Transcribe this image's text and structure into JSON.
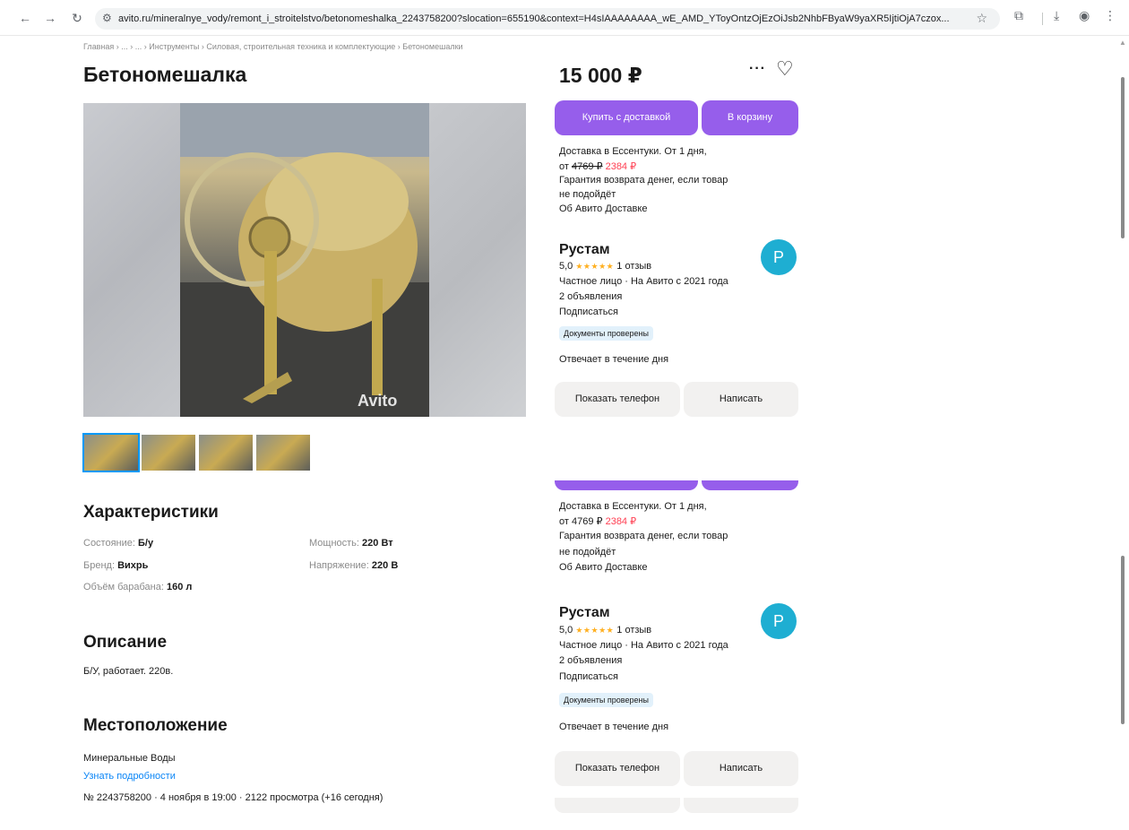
{
  "browser": {
    "url": "avito.ru/mineralnye_vody/remont_i_stroitelstvo/betonomeshalka_2243758200?slocation=655190&context=H4sIAAAAAAAA_wE_AMD_YToyOntzOjEzOiJsb2NhbFByaW9yaXR5IjtiOjA7czox...",
    "icons": [
      "back-icon",
      "forward-icon",
      "reload-icon",
      "site-info-icon",
      "star-icon",
      "extensions-icon",
      "download-icon",
      "profile-icon",
      "menu-icon"
    ]
  },
  "breadcrumbs": "Главная › ... › ... › Инструменты › Силовая, строительная техника и комплектующие › Бетономешалки",
  "title": "Бетономешалка",
  "photo": {
    "watermark": "Avito"
  },
  "thumbnails": [
    {
      "active": true
    },
    {
      "active": false
    },
    {
      "active": false
    },
    {
      "active": false
    }
  ],
  "characteristics": {
    "heading": "Характеристики",
    "items": [
      {
        "key": "Состояние:",
        "value": "Б/у"
      },
      {
        "key": "Бренд:",
        "value": "Вихрь"
      },
      {
        "key": "Объём барабана:",
        "value": "160 л"
      },
      {
        "key": "Мощность:",
        "value": "220 Вт"
      },
      {
        "key": "Напряжение:",
        "value": "220 В"
      }
    ]
  },
  "description": {
    "heading": "Описание",
    "text": "Б/У, работает. 220в."
  },
  "location": {
    "heading": "Местоположение",
    "city": "Минеральные Воды",
    "details_link": "Узнать подробности"
  },
  "meta": "№ 2243758200 · 4 ноября в 19:00 · 2122 просмотра (+16 сегодня)",
  "price": "15 000 ₽",
  "actions": {
    "buy_with_delivery": "Купить с доставкой",
    "to_cart": "В корзину"
  },
  "delivery": {
    "line1": "Доставка в Ессентуки. От 1 дня,",
    "from": "от",
    "old_price": "4769 ₽",
    "new_price": "2384 ₽",
    "guarantee1": "Гарантия возврата денег, если товар",
    "guarantee2": "не подойдёт",
    "about_link": "Об Авито Доставке"
  },
  "seller": {
    "name": "Рустам",
    "avatar_letter": "P",
    "rating": "5,0",
    "stars": "★★★★★",
    "reviews": "1 отзыв",
    "type": "Частное лицо · На Авито с 2021 года",
    "ads": "2 объявления",
    "subscribe": "Подписаться",
    "badge": "Документы проверены",
    "response": "Отвечает в течение дня",
    "show_phone": "Показать телефон",
    "write": "Написать"
  },
  "colors": {
    "accent": "#965eeb",
    "link": "#0a85f6",
    "sale": "#ff4053",
    "avatar": "#1eaed2",
    "star": "#ffb021"
  }
}
